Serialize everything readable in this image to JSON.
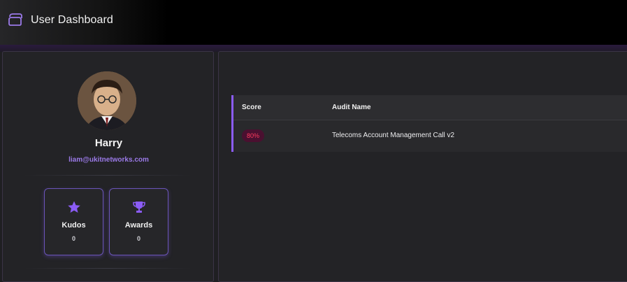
{
  "header": {
    "title": "User Dashboard",
    "logo_icon": "dashboard-logo-icon"
  },
  "profile": {
    "name": "Harry",
    "email": "liam@ukitnetworks.com",
    "avatar": "user-avatar-photo",
    "stats": [
      {
        "label": "Kudos",
        "value": "0",
        "icon": "star-icon"
      },
      {
        "label": "Awards",
        "value": "0",
        "icon": "trophy-icon"
      }
    ]
  },
  "audits": {
    "columns": [
      "Score",
      "Audit Name"
    ],
    "rows": [
      {
        "score": "80%",
        "name": "Telecoms Account Management Call v2"
      }
    ]
  },
  "colors": {
    "accent": "#8b5cf6",
    "email": "#9b7ae8",
    "score_text": "#ff3b5f",
    "score_bg": "#4a1030",
    "panel": "#232326"
  }
}
